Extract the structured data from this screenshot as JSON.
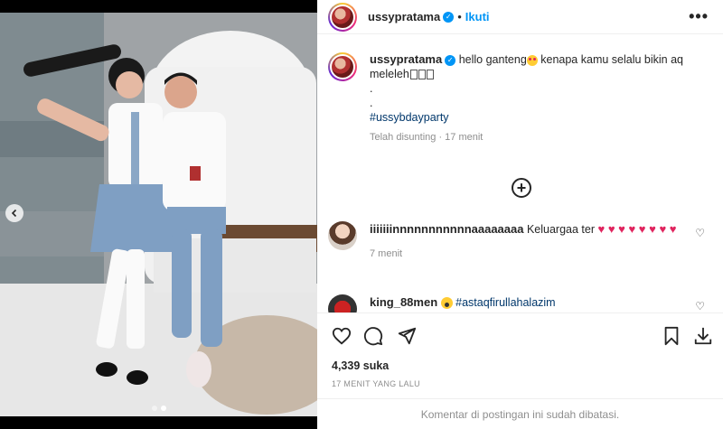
{
  "post": {
    "username": "ussypratama",
    "follow_separator": "•",
    "follow_label": "Ikuti",
    "more_label": "•••"
  },
  "caption": {
    "username": "ussypratama",
    "text_before_emoji": "hello ganteng",
    "text_after_emoji": " kenapa kamu selalu bikin aq meleleh",
    "line_dot_1": ".",
    "line_dot_2": ".",
    "hashtag": "#ussybdayparty",
    "meta": "Telah disunting · 17 menit"
  },
  "comments": [
    {
      "username": "iiiiiiinnnnnnnnnnnaaaaaaaa",
      "text": " Keluargaa ter ",
      "hearts": "♥ ♥ ♥ ♥ ♥ ♥ ♥ ♥",
      "time": "7 menit"
    },
    {
      "username": "king_88men",
      "mention": "#astaqfirullahalazim"
    }
  ],
  "icons": {
    "like": "heart-icon",
    "comment": "comment-icon",
    "share": "send-icon",
    "save": "bookmark-icon",
    "download": "download-icon",
    "load_more": "plus-circle-icon",
    "prev": "chevron-left-icon"
  },
  "stats": {
    "likes": "4,339 suka",
    "time_ago": "17 MENIT YANG LALU"
  },
  "footer": {
    "comments_closed": "Komentar di postingan ini sudah dibatasi."
  },
  "carousel": {
    "slide_count": 2,
    "active_index": 0
  },
  "colors": {
    "accent": "#0095f6",
    "hashtag": "#00376b",
    "muted": "#8e8e8e",
    "heart": "#e0245e"
  }
}
